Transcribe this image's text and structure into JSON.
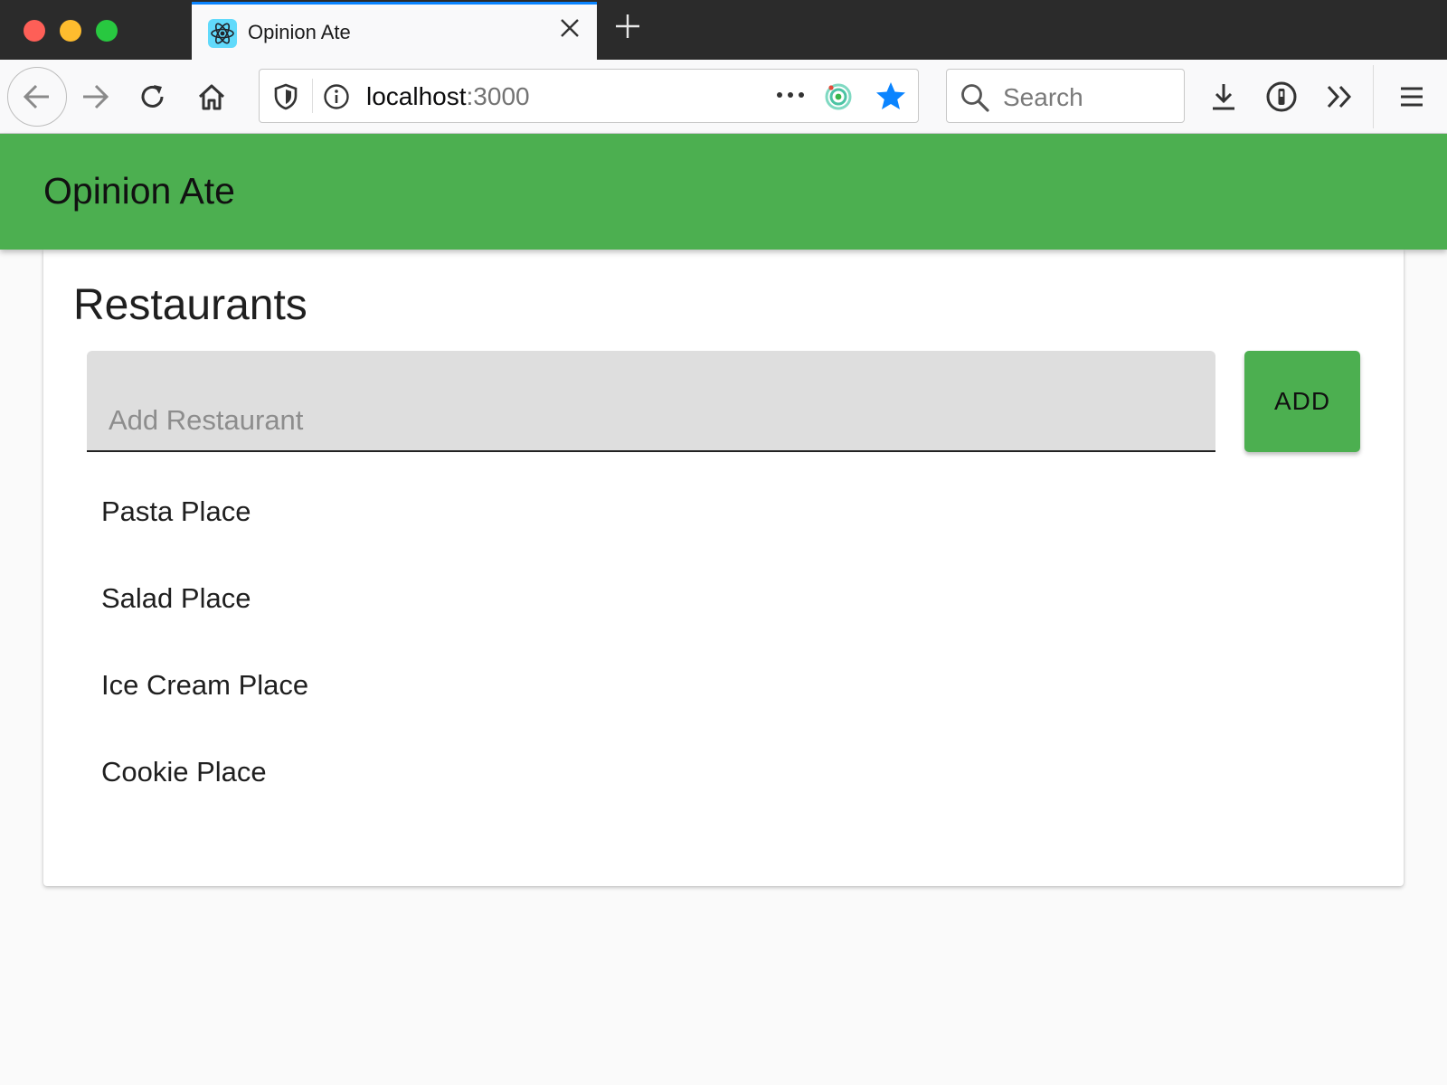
{
  "browser": {
    "tab": {
      "title": "Opinion Ate",
      "favicon": "react-icon"
    },
    "url": {
      "host": "localhost",
      "port": ":3000"
    },
    "search": {
      "placeholder": "Search"
    },
    "colors": {
      "tab_accent": "#0a84ff",
      "star": "#0a84ff"
    }
  },
  "app": {
    "title": "Opinion Ate",
    "accent_color": "#4caf50"
  },
  "main": {
    "heading": "Restaurants",
    "new_restaurant_input": {
      "placeholder": "Add Restaurant",
      "value": ""
    },
    "add_button_label": "ADD",
    "restaurants": [
      {
        "name": "Pasta Place"
      },
      {
        "name": "Salad Place"
      },
      {
        "name": "Ice Cream Place"
      },
      {
        "name": "Cookie Place"
      }
    ]
  }
}
